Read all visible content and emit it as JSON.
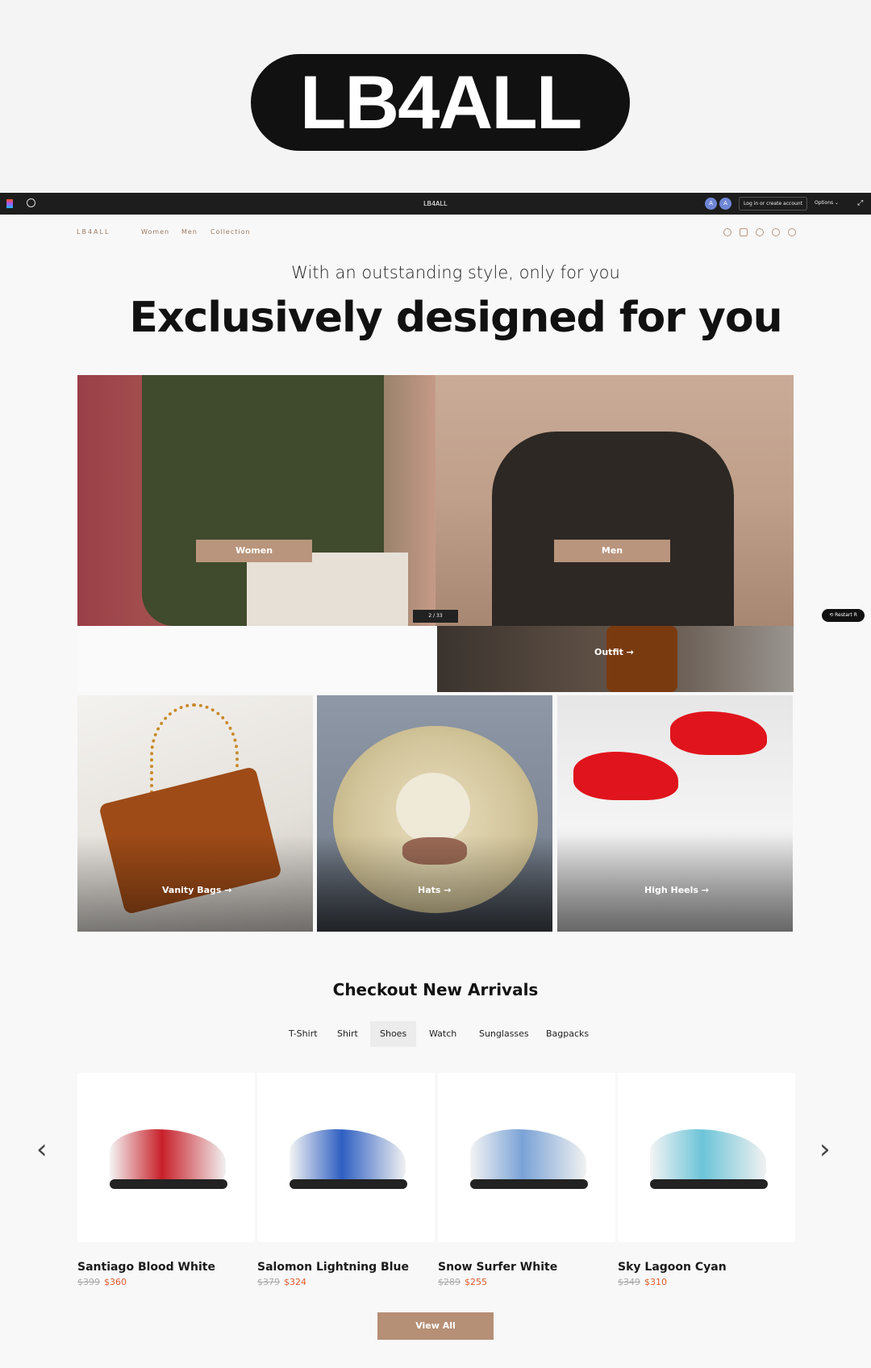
{
  "brand": {
    "logo_text": "LB4ALL"
  },
  "figma": {
    "title": "LB4ALL",
    "avatars": [
      "A",
      "A"
    ],
    "login_label": "Log in or create account",
    "options_label": "Options ⌄"
  },
  "nav": {
    "logo": "LB4ALL",
    "links": [
      "Women",
      "Men",
      "Collection"
    ],
    "icons": [
      "phone-icon",
      "cart-icon",
      "search-icon",
      "user-icon",
      "heart-icon"
    ]
  },
  "hero": {
    "subtitle": "With an outstanding style, only for you",
    "headline": "Exclusively designed for you",
    "women_label": "Women",
    "men_label": "Men",
    "pager": "2 / 33",
    "outfit_label": "Outfit →",
    "restart_label": "⟲ Restart  R"
  },
  "tiles": [
    {
      "label": "Vanity Bags →"
    },
    {
      "label": "Hats →"
    },
    {
      "label": "High Heels →"
    }
  ],
  "arrivals": {
    "title": "Checkout New Arrivals",
    "tabs": [
      "T-Shirt",
      "Shirt",
      "Shoes",
      "Watch",
      "Sunglasses",
      "Bagpacks"
    ],
    "active_tab": "Shoes",
    "products": [
      {
        "name": "Santiago Blood White",
        "old_price": "$399",
        "price": "$360",
        "color": "#c8202a"
      },
      {
        "name": "Salomon Lightning Blue",
        "old_price": "$379",
        "price": "$324",
        "color": "#2e5fc2"
      },
      {
        "name": "Snow Surfer White",
        "old_price": "$289",
        "price": "$255",
        "color": "#7aa2d6"
      },
      {
        "name": "Sky Lagoon Cyan",
        "old_price": "$349",
        "price": "$310",
        "color": "#6cc4d8"
      }
    ],
    "prev_icon": "‹",
    "next_icon": "›",
    "view_all_label": "View All"
  },
  "colors": {
    "accent": "#b58f76",
    "sale": "#e05a2b"
  }
}
